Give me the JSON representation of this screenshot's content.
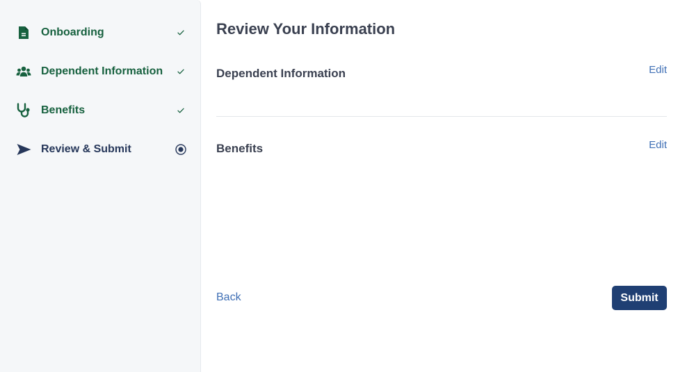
{
  "sidebar": {
    "steps": [
      {
        "label": "Onboarding",
        "icon": "file-icon",
        "status": "completed"
      },
      {
        "label": "Dependent Information",
        "icon": "users-icon",
        "status": "completed"
      },
      {
        "label": "Benefits",
        "icon": "stethoscope-icon",
        "status": "completed"
      },
      {
        "label": "Review & Submit",
        "icon": "send-icon",
        "status": "current"
      }
    ]
  },
  "main": {
    "title": "Review Your Information",
    "sections": [
      {
        "title": "Dependent Information",
        "edit_label": "Edit"
      },
      {
        "title": "Benefits",
        "edit_label": "Edit"
      }
    ],
    "back_label": "Back",
    "submit_label": "Submit"
  },
  "colors": {
    "completed": "#17613f",
    "current": "#26375a",
    "accent": "#1f3f73",
    "link": "#3f6fb5",
    "sidebar_bg": "#f5f7f9"
  }
}
